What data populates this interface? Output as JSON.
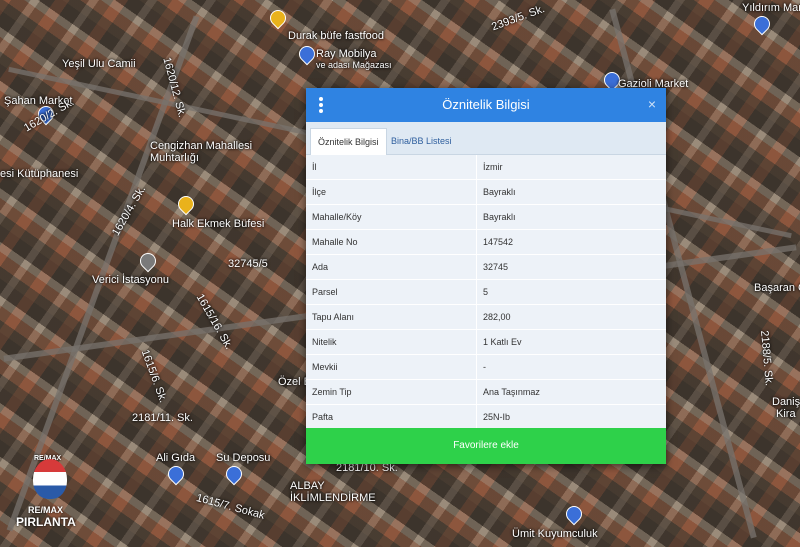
{
  "map": {
    "labels": [
      {
        "id": "durak",
        "text": "Durak büfe fastfood"
      },
      {
        "id": "ray",
        "text": "Ray Mobilya"
      },
      {
        "id": "magaza",
        "text": "ve adası Mağazası"
      },
      {
        "id": "yesil",
        "text": "Yeşil Ulu Camii"
      },
      {
        "id": "sahan",
        "text": "Şahan Market"
      },
      {
        "id": "cengizhan",
        "text": "Cengizhan Mahallesi"
      },
      {
        "id": "muhtarlik",
        "text": "Muhtarlığı"
      },
      {
        "id": "kutuphane",
        "text": "esi Kütüphanesi"
      },
      {
        "id": "halk",
        "text": "Halk Ekmek Büfesi"
      },
      {
        "id": "verici",
        "text": "Verici İstasyonu"
      },
      {
        "id": "parcel",
        "text": "32745/5"
      },
      {
        "id": "s1620",
        "text": "1620/12. Sk."
      },
      {
        "id": "s1620a",
        "text": "1620/2. Sk."
      },
      {
        "id": "s1620b",
        "text": "1620/4. Sk."
      },
      {
        "id": "s1615a",
        "text": "1615/16. Sk."
      },
      {
        "id": "s1615b",
        "text": "1615/6. Sk."
      },
      {
        "id": "s1615c",
        "text": "1615/7. Sokak"
      },
      {
        "id": "s2181",
        "text": "2181/11. Sk."
      },
      {
        "id": "s2181b",
        "text": "2181/10. Sk."
      },
      {
        "id": "s2393",
        "text": "2393/5. Sk."
      },
      {
        "id": "s2188",
        "text": "2188/5. Sk."
      },
      {
        "id": "ali",
        "text": "Ali Gıda"
      },
      {
        "id": "su",
        "text": "Su Deposu"
      },
      {
        "id": "albay",
        "text": "ALBAY"
      },
      {
        "id": "iklim",
        "text": "İKLİMLENDİRME"
      },
      {
        "id": "umit",
        "text": "Ümit Kuyumculuk"
      },
      {
        "id": "gazioli",
        "text": "Gazioli Market"
      },
      {
        "id": "yildirim",
        "text": "Yıldırım Market"
      },
      {
        "id": "basaran",
        "text": "Başaran Ca"
      },
      {
        "id": "danis",
        "text": "Daniş"
      },
      {
        "id": "kira",
        "text": "Kira"
      },
      {
        "id": "ozel",
        "text": "Özel B"
      }
    ]
  },
  "dialog": {
    "title": "Öznitelik Bilgisi",
    "close": "×",
    "tabs": [
      "Öznitelik Bilgisi",
      "Bina/BB Listesi"
    ],
    "rows": [
      {
        "key": "İl",
        "value": "İzmir"
      },
      {
        "key": "İlçe",
        "value": "Bayraklı"
      },
      {
        "key": "Mahalle/Köy",
        "value": "Bayraklı"
      },
      {
        "key": "Mahalle No",
        "value": "147542"
      },
      {
        "key": "Ada",
        "value": "32745"
      },
      {
        "key": "Parsel",
        "value": "5"
      },
      {
        "key": "Tapu Alanı",
        "value": "282,00"
      },
      {
        "key": "Nitelik",
        "value": "1 Katlı Ev"
      },
      {
        "key": "Mevkii",
        "value": "-"
      },
      {
        "key": "Zemin Tip",
        "value": "Ana Taşınmaz"
      },
      {
        "key": "Pafta",
        "value": "25N-Ib"
      }
    ],
    "button": "Favorilere ekle"
  },
  "logo": {
    "top": "RE/MAX",
    "bottom1": "RE/MAX",
    "bottom2": "PIRLANTA"
  },
  "colors": {
    "header": "#2f83e2",
    "button": "#2ed14a"
  }
}
